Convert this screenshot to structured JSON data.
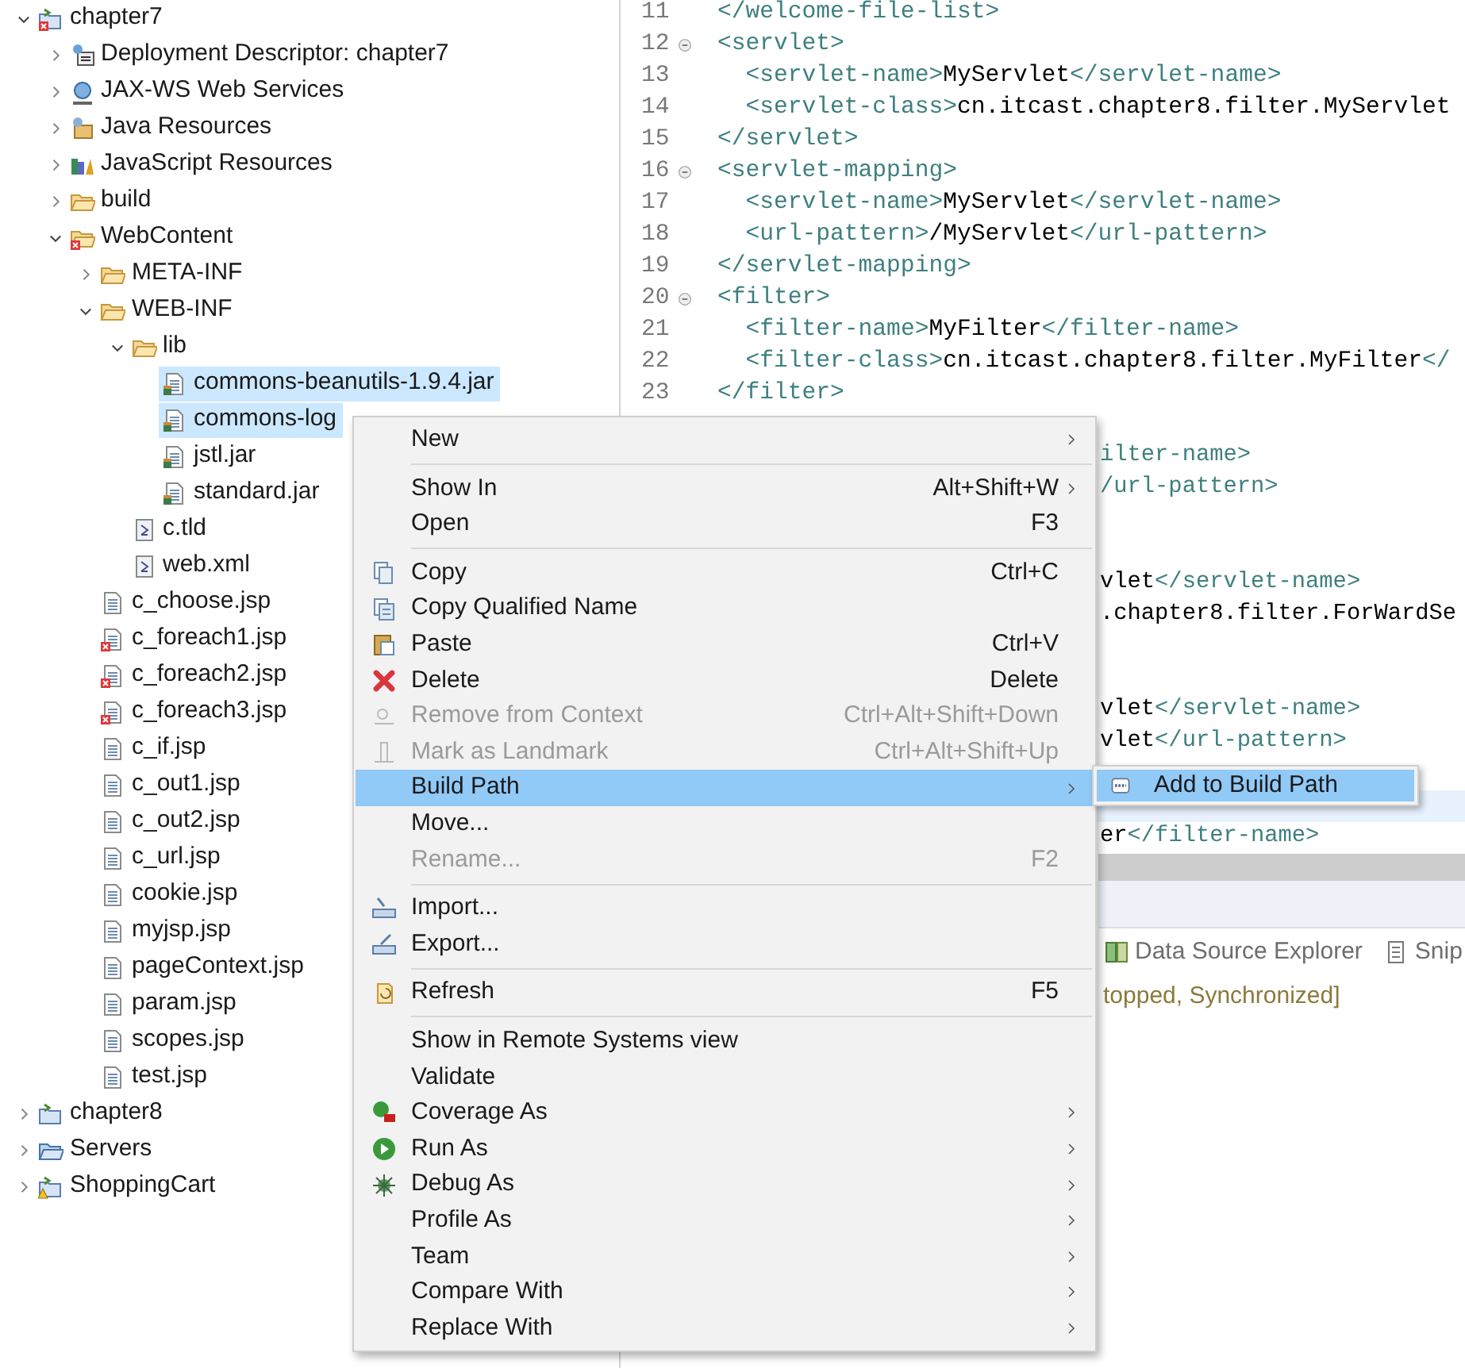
{
  "tree": [
    {
      "label": "chapter7",
      "kind": "project-error",
      "expanded": true,
      "selected": false,
      "children": [
        {
          "label": "Deployment Descriptor: chapter7",
          "kind": "descriptor",
          "expanded": false,
          "selected": false
        },
        {
          "label": "JAX-WS Web Services",
          "kind": "webservices",
          "expanded": false,
          "selected": false
        },
        {
          "label": "Java Resources",
          "kind": "java-res",
          "expanded": false,
          "selected": false
        },
        {
          "label": "JavaScript Resources",
          "kind": "js-res",
          "expanded": false,
          "selected": false
        },
        {
          "label": "build",
          "kind": "folder",
          "expanded": false,
          "selected": false
        },
        {
          "label": "WebContent",
          "kind": "folder-error",
          "expanded": true,
          "selected": false,
          "children": [
            {
              "label": "META-INF",
              "kind": "folder",
              "expanded": false,
              "selected": false
            },
            {
              "label": "WEB-INF",
              "kind": "folder",
              "expanded": true,
              "selected": false,
              "children": [
                {
                  "label": "lib",
                  "kind": "folder",
                  "expanded": true,
                  "selected": false,
                  "children": [
                    {
                      "label": "commons-beanutils-1.9.4.jar",
                      "kind": "jar",
                      "selected": true
                    },
                    {
                      "label": "commons-log",
                      "kind": "jar",
                      "selected": true
                    },
                    {
                      "label": "jstl.jar",
                      "kind": "jar",
                      "selected": false
                    },
                    {
                      "label": "standard.jar",
                      "kind": "jar",
                      "selected": false
                    }
                  ]
                },
                {
                  "label": "c.tld",
                  "kind": "xml",
                  "selected": false
                },
                {
                  "label": "web.xml",
                  "kind": "xml",
                  "selected": false
                }
              ]
            },
            {
              "label": "c_choose.jsp",
              "kind": "jsp",
              "selected": false
            },
            {
              "label": "c_foreach1.jsp",
              "kind": "jsp-error",
              "selected": false
            },
            {
              "label": "c_foreach2.jsp",
              "kind": "jsp-error",
              "selected": false
            },
            {
              "label": "c_foreach3.jsp",
              "kind": "jsp-error",
              "selected": false
            },
            {
              "label": "c_if.jsp",
              "kind": "jsp",
              "selected": false
            },
            {
              "label": "c_out1.jsp",
              "kind": "jsp",
              "selected": false
            },
            {
              "label": "c_out2.jsp",
              "kind": "jsp",
              "selected": false
            },
            {
              "label": "c_url.jsp",
              "kind": "jsp",
              "selected": false
            },
            {
              "label": "cookie.jsp",
              "kind": "jsp",
              "selected": false
            },
            {
              "label": "myjsp.jsp",
              "kind": "jsp",
              "selected": false
            },
            {
              "label": "pageContext.jsp",
              "kind": "jsp",
              "selected": false
            },
            {
              "label": "param.jsp",
              "kind": "jsp",
              "selected": false
            },
            {
              "label": "scopes.jsp",
              "kind": "jsp",
              "selected": false
            },
            {
              "label": "test.jsp",
              "kind": "jsp",
              "selected": false
            }
          ]
        }
      ]
    },
    {
      "label": "chapter8",
      "kind": "project",
      "expanded": false,
      "selected": false
    },
    {
      "label": "Servers",
      "kind": "servers",
      "expanded": false,
      "selected": false
    },
    {
      "label": "ShoppingCart",
      "kind": "project-warn",
      "expanded": false,
      "selected": false
    }
  ],
  "editor": {
    "lines": [
      {
        "number": "11",
        "code": "</welcome-file-list>"
      },
      {
        "number": "12",
        "fold": true,
        "code": "<servlet>"
      },
      {
        "number": "13",
        "code": "  <servlet-name>MyServlet</servlet-name>"
      },
      {
        "number": "14",
        "code": "  <servlet-class>cn.itcast.chapter8.filter.MyServlet"
      },
      {
        "number": "15",
        "code": "</servlet>"
      },
      {
        "number": "16",
        "fold": true,
        "code": "<servlet-mapping>"
      },
      {
        "number": "17",
        "code": "  <servlet-name>MyServlet</servlet-name>"
      },
      {
        "number": "18",
        "code": "  <url-pattern>/MyServlet</url-pattern>"
      },
      {
        "number": "19",
        "code": "</servlet-mapping>"
      },
      {
        "number": "20",
        "fold": true,
        "code": "<filter>"
      },
      {
        "number": "21",
        "code": "  <filter-name>MyFilter</filter-name>"
      },
      {
        "number": "22",
        "code": "  <filter-class>cn.itcast.chapter8.filter.MyFilter</"
      },
      {
        "number": "23",
        "code": "</filter>"
      }
    ],
    "fragments": [
      "ilter-name>",
      "/url-pattern>",
      "vlet</servlet-name>",
      ".chapter8.filter.ForWardSe",
      "vlet</servlet-name>",
      "vlet</url-pattern>",
      "er</filter-name>"
    ]
  },
  "bottom_panel": {
    "tabs": [
      {
        "label": "Data Source Explorer",
        "kind": "database",
        "selected": false
      },
      {
        "label": "Snip",
        "kind": "snippet",
        "selected": false
      }
    ],
    "lines": [
      "topped, Synchronized]"
    ]
  },
  "context_menu": {
    "groups": [
      [
        {
          "label": "New",
          "kind": "plain",
          "submenu": true,
          "disabled": false,
          "selected": false
        }
      ],
      [
        {
          "label": "Show In",
          "kind": "plain",
          "shortcut": "Alt+Shift+W",
          "submenu": true,
          "disabled": false,
          "selected": false
        },
        {
          "label": "Open",
          "kind": "plain",
          "shortcut": "F3",
          "disabled": false,
          "selected": false
        }
      ],
      [
        {
          "label": "Copy",
          "kind": "copy",
          "shortcut": "Ctrl+C",
          "disabled": false,
          "selected": false
        },
        {
          "label": "Copy Qualified Name",
          "kind": "copy-name",
          "disabled": false,
          "selected": false
        },
        {
          "label": "Paste",
          "kind": "paste",
          "shortcut": "Ctrl+V",
          "disabled": false,
          "selected": false
        },
        {
          "label": "Delete",
          "kind": "delete",
          "shortcut": "Delete",
          "disabled": false,
          "selected": false
        },
        {
          "label": "Remove from Context",
          "kind": "remove",
          "shortcut": "Ctrl+Alt+Shift+Down",
          "disabled": true,
          "selected": false
        },
        {
          "label": "Mark as Landmark",
          "kind": "landmark",
          "shortcut": "Ctrl+Alt+Shift+Up",
          "disabled": true,
          "selected": false
        },
        {
          "label": "Build Path",
          "kind": "plain",
          "submenu": true,
          "disabled": false,
          "selected": true
        },
        {
          "label": "Move...",
          "kind": "plain",
          "disabled": false,
          "selected": false
        },
        {
          "label": "Rename...",
          "kind": "plain",
          "shortcut": "F2",
          "disabled": true,
          "selected": false
        }
      ],
      [
        {
          "label": "Import...",
          "kind": "import",
          "disabled": false,
          "selected": false
        },
        {
          "label": "Export...",
          "kind": "export",
          "disabled": false,
          "selected": false
        }
      ],
      [
        {
          "label": "Refresh",
          "kind": "refresh",
          "shortcut": "F5",
          "disabled": false,
          "selected": false
        }
      ],
      [
        {
          "label": "Show in Remote Systems view",
          "kind": "plain",
          "disabled": false,
          "selected": false
        },
        {
          "label": "Validate",
          "kind": "plain",
          "disabled": false,
          "selected": false
        },
        {
          "label": "Coverage As",
          "kind": "coverage",
          "submenu": true,
          "disabled": false,
          "selected": false
        },
        {
          "label": "Run As",
          "kind": "run",
          "submenu": true,
          "disabled": false,
          "selected": false
        },
        {
          "label": "Debug As",
          "kind": "debug",
          "submenu": true,
          "disabled": false,
          "selected": false
        },
        {
          "label": "Profile As",
          "kind": "plain",
          "submenu": true,
          "disabled": false,
          "selected": false
        },
        {
          "label": "Team",
          "kind": "plain",
          "submenu": true,
          "disabled": false,
          "selected": false
        },
        {
          "label": "Compare With",
          "kind": "plain",
          "submenu": true,
          "disabled": false,
          "selected": false
        },
        {
          "label": "Replace With",
          "kind": "plain",
          "submenu": true,
          "disabled": false,
          "selected": false
        }
      ]
    ]
  },
  "submenu": {
    "items": [
      {
        "label": "Add to Build Path",
        "kind": "classpath",
        "selected": true
      }
    ]
  }
}
